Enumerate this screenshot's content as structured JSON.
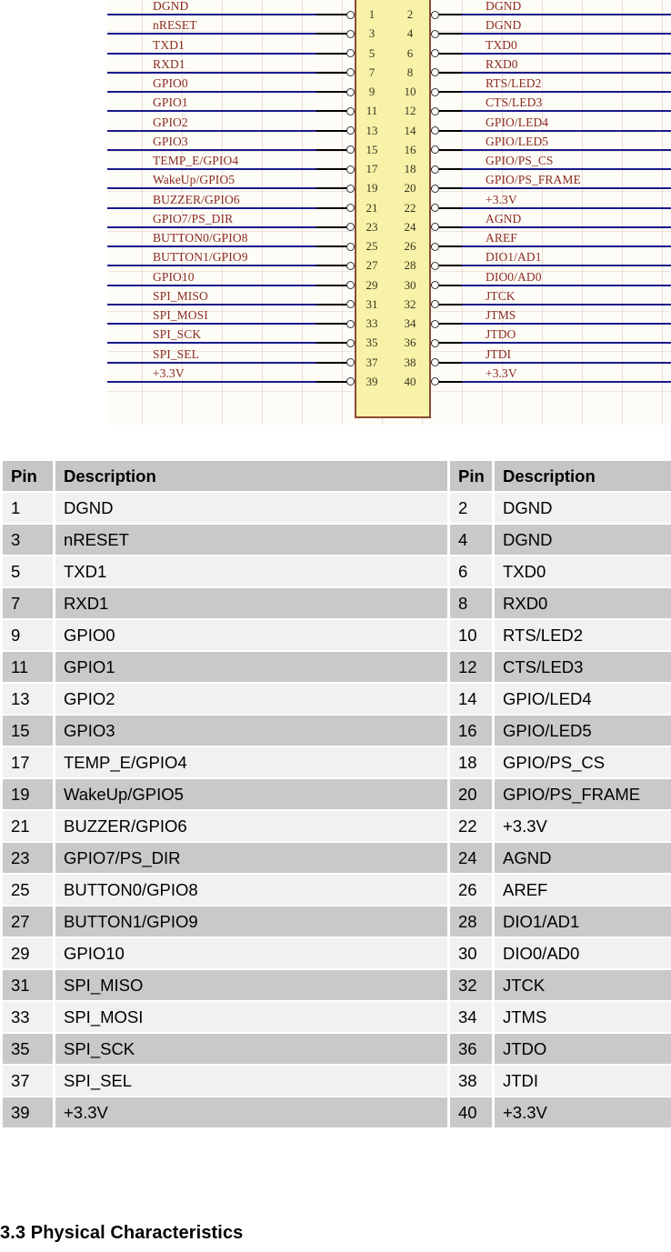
{
  "schematic": {
    "connector_pin_numbers": [
      1,
      2,
      3,
      4,
      5,
      6,
      7,
      8,
      9,
      10,
      11,
      12,
      13,
      14,
      15,
      16,
      17,
      18,
      19,
      20,
      21,
      22,
      23,
      24,
      25,
      26,
      27,
      28,
      29,
      30,
      31,
      32,
      33,
      34,
      35,
      36,
      37,
      38,
      39,
      40
    ],
    "left_labels": [
      "DGND",
      "nRESET",
      "TXD1",
      "RXD1",
      "GPIO0",
      "GPIO1",
      "GPIO2",
      "GPIO3",
      "TEMP_E/GPIO4",
      "WakeUp/GPIO5",
      "BUZZER/GPIO6",
      "GPIO7/PS_DIR",
      "BUTTON0/GPIO8",
      "BUTTON1/GPIO9",
      "GPIO10",
      "SPI_MISO",
      "SPI_MOSI",
      "SPI_SCK",
      "SPI_SEL",
      "+3.3V"
    ],
    "right_labels": [
      "DGND",
      "DGND",
      "TXD0",
      "RXD0",
      "RTS/LED2",
      "CTS/LED3",
      "GPIO/LED4",
      "GPIO/LED5",
      "GPIO/PS_CS",
      "GPIO/PS_FRAME",
      "+3.3V",
      "AGND",
      "AREF",
      "DIO1/AD1",
      "DIO0/AD0",
      "JTCK",
      "JTMS",
      "JTDO",
      "JTDI",
      "+3.3V"
    ],
    "colors": {
      "net_line": "#1a1a8c",
      "label_text": "#8b2a20",
      "connector_fill": "#f7f2a8",
      "connector_border": "#8a4b32",
      "background": "#fdfcf6"
    }
  },
  "table": {
    "headers": [
      "Pin",
      "Description",
      "Pin",
      "Description"
    ],
    "rows": [
      [
        "1",
        "DGND",
        "2",
        "DGND"
      ],
      [
        "3",
        "nRESET",
        "4",
        "DGND"
      ],
      [
        "5",
        "TXD1",
        "6",
        "TXD0"
      ],
      [
        "7",
        "RXD1",
        "8",
        "RXD0"
      ],
      [
        "9",
        "GPIO0",
        "10",
        "RTS/LED2"
      ],
      [
        "11",
        "GPIO1",
        "12",
        "CTS/LED3"
      ],
      [
        "13",
        "GPIO2",
        "14",
        "GPIO/LED4"
      ],
      [
        "15",
        "GPIO3",
        "16",
        "GPIO/LED5"
      ],
      [
        "17",
        "TEMP_E/GPIO4",
        "18",
        "GPIO/PS_CS"
      ],
      [
        "19",
        "WakeUp/GPIO5",
        "20",
        "GPIO/PS_FRAME"
      ],
      [
        "21",
        "BUZZER/GPIO6",
        "22",
        "+3.3V"
      ],
      [
        "23",
        "GPIO7/PS_DIR",
        "24",
        "AGND"
      ],
      [
        "25",
        "BUTTON0/GPIO8",
        "26",
        "AREF"
      ],
      [
        "27",
        "BUTTON1/GPIO9",
        "28",
        "DIO1/AD1"
      ],
      [
        "29",
        "GPIO10",
        "30",
        "DIO0/AD0"
      ],
      [
        "31",
        "SPI_MISO",
        "32",
        "JTCK"
      ],
      [
        "33",
        "SPI_MOSI",
        "34",
        "JTMS"
      ],
      [
        "35",
        "SPI_SCK",
        "36",
        "JTDO"
      ],
      [
        "37",
        "SPI_SEL",
        "38",
        "JTDI"
      ],
      [
        "39",
        "+3.3V",
        "40",
        "+3.3V"
      ]
    ],
    "colors": {
      "header_bg": "#c6c6c6",
      "row_odd_bg": "#f1f1f1",
      "row_even_bg": "#c9c9c9",
      "text": "#000000"
    }
  },
  "section_heading": "3.3 Physical Characteristics"
}
